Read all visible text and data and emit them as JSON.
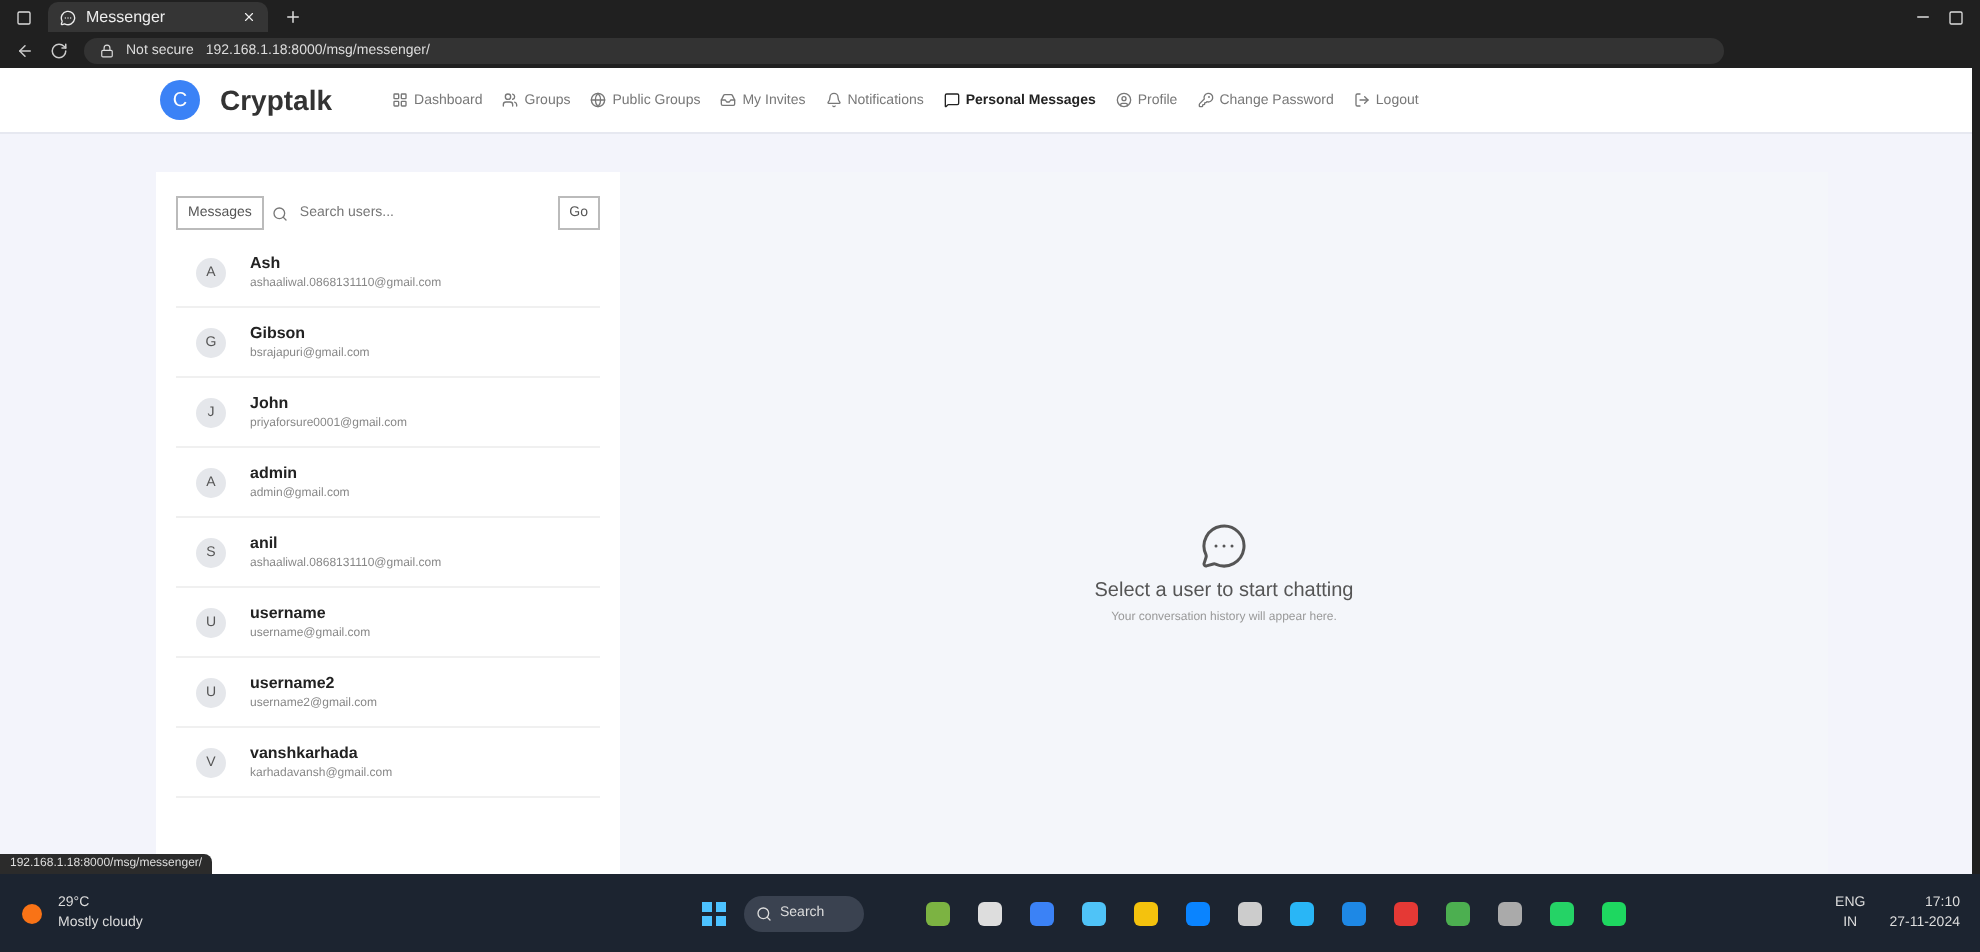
{
  "browser": {
    "tab_title": "Messenger",
    "security": "Not secure",
    "url": "192.168.1.18:8000/msg/messenger/",
    "status_url": "192.168.1.18:8000/msg/messenger/"
  },
  "navbar": {
    "brand": "Cryptalk",
    "brand_mark": "C",
    "items": [
      {
        "label": "Dashboard",
        "selected": false
      },
      {
        "label": "Groups",
        "selected": false
      },
      {
        "label": "Public Groups",
        "selected": false
      },
      {
        "label": "My Invites",
        "selected": false
      },
      {
        "label": "Notifications",
        "selected": false
      },
      {
        "label": "Personal Messages",
        "selected": true
      },
      {
        "label": "Profile",
        "selected": false
      },
      {
        "label": "Change Password",
        "selected": false
      },
      {
        "label": "Logout",
        "selected": false
      }
    ]
  },
  "sidebar": {
    "filter_button": "Messages",
    "search": {
      "placeholder": "Search users..."
    },
    "go_button": "Go",
    "users": [
      {
        "initial": "A",
        "name": "Ash",
        "email": "ashaaliwal.0868131110@gmail.com"
      },
      {
        "initial": "G",
        "name": "Gibson",
        "email": "bsrajapuri@gmail.com"
      },
      {
        "initial": "J",
        "name": "John",
        "email": "priyaforsure0001@gmail.com"
      },
      {
        "initial": "A",
        "name": "admin",
        "email": "admin@gmail.com"
      },
      {
        "initial": "S",
        "name": "anil",
        "email": "ashaaliwal.0868131110@gmail.com"
      },
      {
        "initial": "U",
        "name": "username",
        "email": "username@gmail.com"
      },
      {
        "initial": "U",
        "name": "username2",
        "email": "username2@gmail.com"
      },
      {
        "initial": "V",
        "name": "vanshkarhada",
        "email": "karhadavansh@gmail.com"
      }
    ]
  },
  "chat": {
    "title": "Select a user to start chatting",
    "subtitle": "Your conversation history will appear here."
  },
  "taskbar": {
    "weather": "29°C",
    "weather_note": "Mostly cloudy",
    "search": "Search",
    "language": "ENG",
    "region": "IN",
    "time": "17:10",
    "date": "27-11-2024"
  }
}
